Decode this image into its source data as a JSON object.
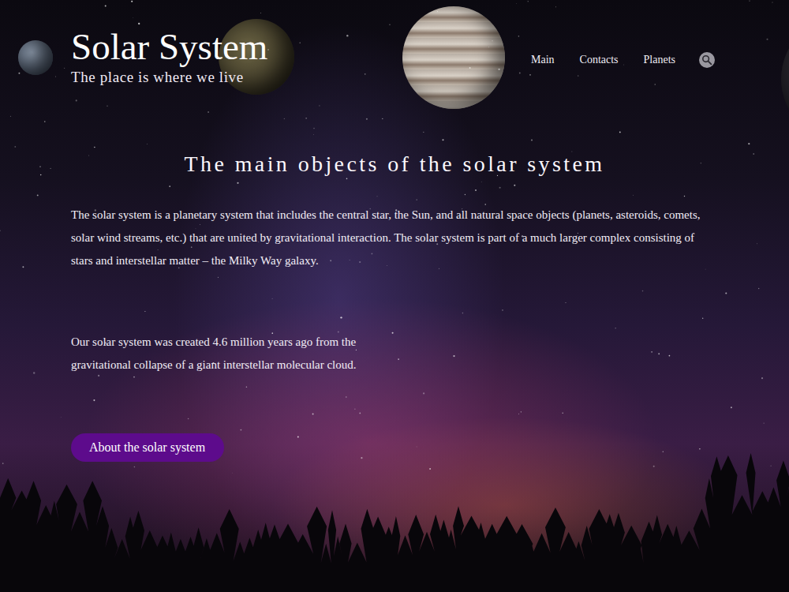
{
  "header": {
    "title": "Solar System",
    "tagline": "The place is where we live"
  },
  "nav": {
    "items": [
      {
        "label": "Main"
      },
      {
        "label": "Contacts"
      },
      {
        "label": "Planets"
      }
    ]
  },
  "main": {
    "heading": "The main objects of the solar system",
    "paragraphs": [
      "The solar system is a planetary system that includes the central star, the Sun, and all natural space objects (planets, asteroids, comets, solar wind streams, etc.) that are united by gravitational interaction. The solar system is part of a much larger complex consisting of stars and interstellar matter – the Milky Way galaxy.",
      "Our solar system was created 4.6 million years ago from the gravitational collapse of a giant interstellar molecular cloud."
    ],
    "button": "About the solar system"
  }
}
